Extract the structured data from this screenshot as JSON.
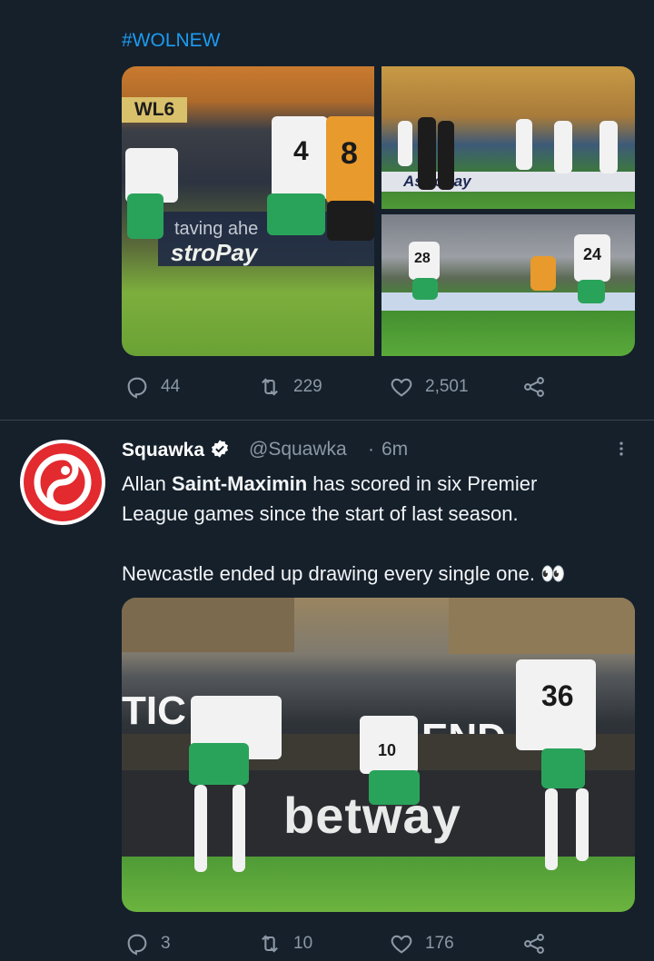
{
  "tweet1": {
    "hashtag": "#WOLNEW",
    "photos": {
      "p1_ad1": "taving ahe",
      "p1_ad2": "stroPay",
      "p1_sign": "WL6",
      "p1_num_white": "4",
      "p1_num_orange": "8",
      "p2_ad": "AstroPay",
      "p3_num1": "28",
      "p3_num2": "24"
    },
    "replies": "44",
    "retweets": "229",
    "likes": "2,501"
  },
  "tweet2": {
    "name": "Squawka",
    "handle": "@Squawka",
    "separator": "·",
    "time": "6m",
    "text_line1_pre": "Allan ",
    "text_line1_bold": "Saint-Maximin",
    "text_line1_post": " has scored in six Premier",
    "text_line2": "League games since the start of last season.",
    "text_line3": "Newcastle ended up drawing every single one. 👀",
    "photo": {
      "ad_text": "betway",
      "left_sign": "TIC",
      "right_sign": "END",
      "shirt_number": "36",
      "shirt_number2": "10"
    },
    "replies": "3",
    "retweets": "10",
    "likes": "176"
  },
  "colors": {
    "background": "#15202b",
    "accent": "#1d9bf0",
    "muted": "#8b98a5",
    "avatar": "#e22a2f"
  }
}
